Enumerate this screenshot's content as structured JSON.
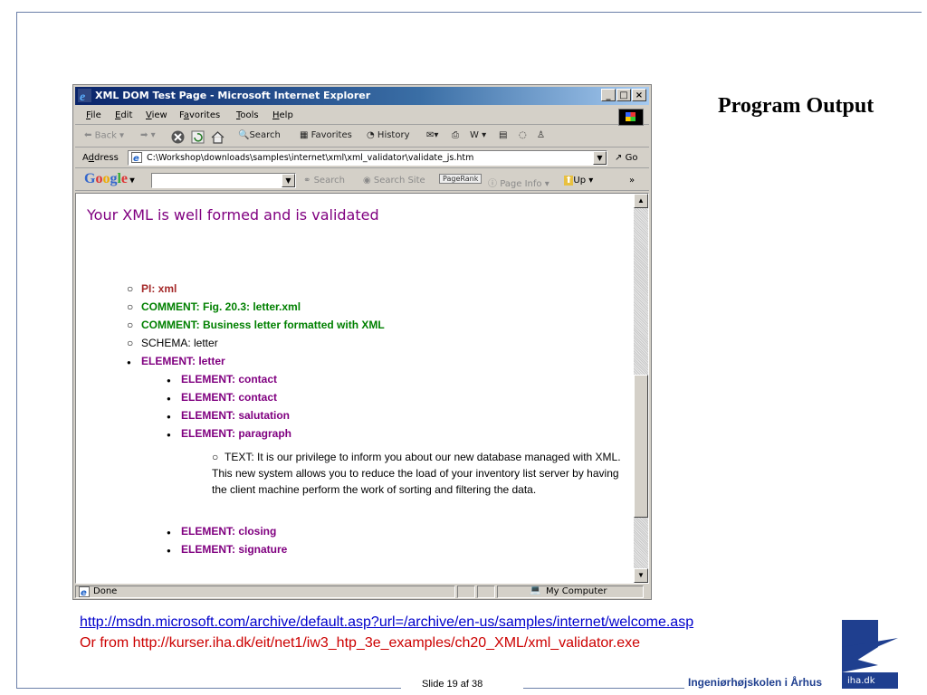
{
  "slide": {
    "title": "Program Output",
    "link_url": "http://msdn.microsoft.com/archive/default.asp?url=/archive/en-us/samples/internet/welcome.asp",
    "alt_text": "Or from http://kurser.iha.dk/eit/net1/iw3_htp_3e_examples/ch20_XML/xml_validator.exe",
    "footer_slide": "Slide 19 af  38",
    "footer_school": "Ingeniørhøjskolen i Århus",
    "logo_text": "iha.dk"
  },
  "window": {
    "title": "XML DOM Test Page - Microsoft Internet Explorer",
    "buttons": {
      "minimize": "_",
      "maximize": "□",
      "close": "×"
    }
  },
  "menu": {
    "file": {
      "u": "F",
      "rest": "ile"
    },
    "edit": {
      "u": "E",
      "rest": "dit"
    },
    "view": {
      "u": "V",
      "rest": "iew"
    },
    "favorites": {
      "pre": "F",
      "u": "a",
      "rest": "vorites"
    },
    "tools": {
      "u": "T",
      "rest": "ools"
    },
    "help": {
      "u": "H",
      "rest": "elp"
    }
  },
  "toolbar": {
    "back": "Back",
    "search": "Search",
    "favorites": "Favorites",
    "history": "History"
  },
  "address": {
    "label_pre": "A",
    "label_u": "d",
    "label_rest": "dress",
    "value": "C:\\Workshop\\downloads\\samples\\internet\\xml\\xml_validator\\validate_js.htm",
    "go": "Go"
  },
  "google": {
    "logo": [
      "G",
      "o",
      "o",
      "g",
      "l",
      "e"
    ],
    "search": "Search",
    "search_site": "Search Site",
    "pagerank": "PageRank",
    "page_info": "Page Info",
    "up": "Up",
    "more": "»"
  },
  "content": {
    "heading": "Your XML is well formed and is validated",
    "nodes": [
      {
        "bullet": "○",
        "label": "PI: xml"
      },
      {
        "bullet": "○",
        "label": "COMMENT: Fig. 20.3: letter.xml"
      },
      {
        "bullet": "○",
        "label": "COMMENT: Business letter formatted with XML"
      },
      {
        "bullet": "○",
        "label": "SCHEMA: letter"
      },
      {
        "bullet": "●",
        "label": "ELEMENT: letter"
      },
      {
        "bullet": "●",
        "label": "ELEMENT: contact"
      },
      {
        "bullet": "●",
        "label": "ELEMENT: contact"
      },
      {
        "bullet": "●",
        "label": "ELEMENT: salutation"
      },
      {
        "bullet": "●",
        "label": "ELEMENT: paragraph"
      },
      {
        "bullet": "●",
        "label": "ELEMENT: closing"
      },
      {
        "bullet": "●",
        "label": "ELEMENT: signature"
      }
    ],
    "text_node": {
      "bullet": "○",
      "text": "TEXT: It is our privilege to inform you about our new database managed with XML. This new system allows you to reduce the load of your inventory list server by having the client machine perform the work of sorting and filtering the data."
    }
  },
  "status": {
    "text": "Done",
    "zone": "My Computer"
  }
}
